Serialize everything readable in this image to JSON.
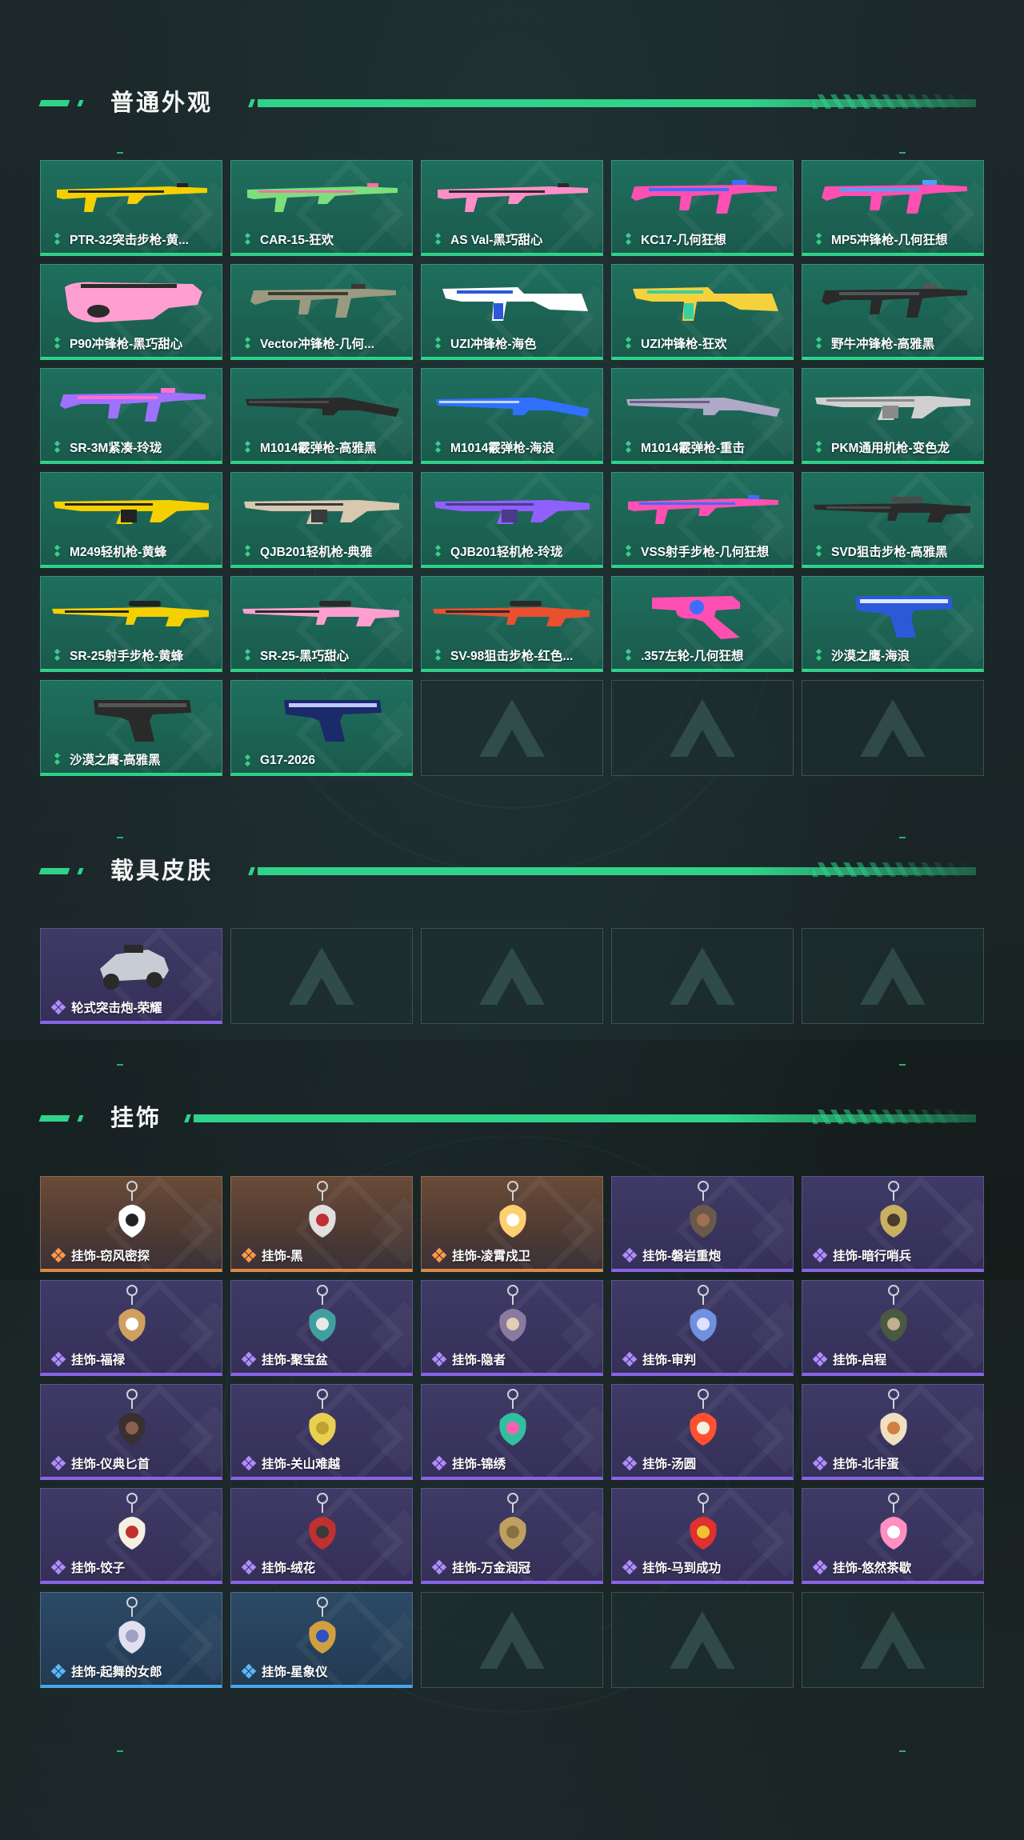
{
  "sections": {
    "weapons": {
      "title": "普通外观"
    },
    "vehicles": {
      "title": "载具皮肤"
    },
    "charms": {
      "title": "挂饰"
    }
  },
  "weapons": [
    {
      "label": "PTR-32突击步枪-黄...",
      "icon": "rifle",
      "colors": [
        "#f5d000",
        "#222"
      ]
    },
    {
      "label": "CAR-15-狂欢",
      "icon": "rifle",
      "colors": [
        "#7be07b",
        "#ff6ea8"
      ]
    },
    {
      "label": "AS Val-黑巧甜心",
      "icon": "rifle",
      "colors": [
        "#ff8ec8",
        "#2a2a2a"
      ]
    },
    {
      "label": "KC17-几何狂想",
      "icon": "smg",
      "colors": [
        "#ff4fb2",
        "#3f6cff"
      ]
    },
    {
      "label": "MP5冲锋枪-几何狂想",
      "icon": "smg",
      "colors": [
        "#ff4fb2",
        "#4fa0ff"
      ]
    },
    {
      "label": "P90冲锋枪-黑巧甜心",
      "icon": "p90",
      "colors": [
        "#ff9ed0",
        "#2a2a2a"
      ]
    },
    {
      "label": "Vector冲锋枪-几何...",
      "icon": "smg",
      "colors": [
        "#9a9a80",
        "#3a3a30"
      ]
    },
    {
      "label": "UZI冲锋枪-海色",
      "icon": "uzi",
      "colors": [
        "#ffffff",
        "#2a5ad8"
      ]
    },
    {
      "label": "UZI冲锋枪-狂欢",
      "icon": "uzi",
      "colors": [
        "#f5d23b",
        "#3ad0a0"
      ]
    },
    {
      "label": "野牛冲锋枪-高雅黑",
      "icon": "smg",
      "colors": [
        "#2a2a2a",
        "#555"
      ]
    },
    {
      "label": "SR-3M紧凑-玲珑",
      "icon": "smg",
      "colors": [
        "#a070ff",
        "#ff70d0"
      ]
    },
    {
      "label": "M1014霰弹枪-高雅黑",
      "icon": "shotgun",
      "colors": [
        "#2a2a2a",
        "#4a4a4a"
      ]
    },
    {
      "label": "M1014霰弹枪-海浪",
      "icon": "shotgun",
      "colors": [
        "#3070ff",
        "#c0d8ff"
      ]
    },
    {
      "label": "M1014霰弹枪-重击",
      "icon": "shotgun",
      "colors": [
        "#b0a8c8",
        "#6a6080"
      ]
    },
    {
      "label": "PKM通用机枪-变色龙",
      "icon": "lmg",
      "colors": [
        "#d0d0d0",
        "#8a8a8a"
      ]
    },
    {
      "label": "M249轻机枪-黄蜂",
      "icon": "lmg",
      "colors": [
        "#f5d000",
        "#222"
      ]
    },
    {
      "label": "QJB201轻机枪-典雅",
      "icon": "lmg",
      "colors": [
        "#d8c8b0",
        "#3a3a3a"
      ]
    },
    {
      "label": "QJB201轻机枪-玲珑",
      "icon": "lmg",
      "colors": [
        "#9060ff",
        "#4a3a8a"
      ]
    },
    {
      "label": "VSS射手步枪-几何狂想",
      "icon": "rifle",
      "colors": [
        "#ff4fb2",
        "#3f6cff"
      ]
    },
    {
      "label": "SVD狙击步枪-高雅黑",
      "icon": "sniper",
      "colors": [
        "#2a2a2a",
        "#4a4a4a"
      ]
    },
    {
      "label": "SR-25射手步枪-黄蜂",
      "icon": "sniper",
      "colors": [
        "#f5d000",
        "#222"
      ]
    },
    {
      "label": "SR-25-黑巧甜心",
      "icon": "sniper",
      "colors": [
        "#ff9ed0",
        "#2a2a2a"
      ]
    },
    {
      "label": "SV-98狙击步枪-红色...",
      "icon": "sniper",
      "colors": [
        "#e85030",
        "#2a2a2a"
      ]
    },
    {
      "label": ".357左轮-几何狂想",
      "icon": "revolver",
      "colors": [
        "#ff4fb2",
        "#3f6cff"
      ]
    },
    {
      "label": "沙漠之鹰-海浪",
      "icon": "pistol",
      "colors": [
        "#2a5ad8",
        "#e0e8ff"
      ]
    },
    {
      "label": "沙漠之鹰-高雅黑",
      "icon": "pistol",
      "colors": [
        "#2a2a2a",
        "#555"
      ]
    },
    {
      "label": "G17-2026",
      "icon": "pistol",
      "colors": [
        "#1a2a6a",
        "#c0c8ff"
      ]
    }
  ],
  "vehicles": [
    {
      "label": "轮式突击炮-荣耀",
      "icon": "vehicle",
      "colors": [
        "#c8ccd4",
        "#2a2a2a"
      ]
    }
  ],
  "charms": [
    {
      "label": "挂饰-窃风密探",
      "rarity": "orange",
      "colors": [
        "#ffffff",
        "#222"
      ]
    },
    {
      "label": "挂饰-黑",
      "rarity": "orange",
      "colors": [
        "#e0e0e0",
        "#c03030"
      ]
    },
    {
      "label": "挂饰-凌霄戍卫",
      "rarity": "orange",
      "colors": [
        "#ffd070",
        "#ffffff"
      ]
    },
    {
      "label": "挂饰-磐岩重炮",
      "rarity": "purple",
      "colors": [
        "#6a5a4a",
        "#a07050"
      ]
    },
    {
      "label": "挂饰-暗行哨兵",
      "rarity": "purple",
      "colors": [
        "#c8b060",
        "#4a3a30"
      ]
    },
    {
      "label": "挂饰-福禄",
      "rarity": "purple",
      "colors": [
        "#d0a060",
        "#ffffff"
      ]
    },
    {
      "label": "挂饰-聚宝盆",
      "rarity": "purple",
      "colors": [
        "#40a0a0",
        "#e8e8e8"
      ]
    },
    {
      "label": "挂饰-隐者",
      "rarity": "purple",
      "colors": [
        "#8a7aa0",
        "#e0d0b0"
      ]
    },
    {
      "label": "挂饰-审判",
      "rarity": "purple",
      "colors": [
        "#7090e0",
        "#e0e0ff"
      ]
    },
    {
      "label": "挂饰-启程",
      "rarity": "purple",
      "colors": [
        "#4a5a40",
        "#c0b090"
      ]
    },
    {
      "label": "挂饰-仪典匕首",
      "rarity": "purple",
      "colors": [
        "#3a3030",
        "#8a6050"
      ]
    },
    {
      "label": "挂饰-关山难越",
      "rarity": "purple",
      "colors": [
        "#e8d050",
        "#c0a030"
      ]
    },
    {
      "label": "挂饰-锦绣",
      "rarity": "purple",
      "colors": [
        "#30c0a0",
        "#ff60b0"
      ]
    },
    {
      "label": "挂饰-汤圆",
      "rarity": "purple",
      "colors": [
        "#ff5030",
        "#f5f0e0"
      ]
    },
    {
      "label": "挂饰-北非蛋",
      "rarity": "purple",
      "colors": [
        "#f0e0c0",
        "#d08040"
      ]
    },
    {
      "label": "挂饰-饺子",
      "rarity": "purple",
      "colors": [
        "#f5f0e0",
        "#c03030"
      ]
    },
    {
      "label": "挂饰-绒花",
      "rarity": "purple",
      "colors": [
        "#c03030",
        "#3a3a3a"
      ]
    },
    {
      "label": "挂饰-万金润冠",
      "rarity": "purple",
      "colors": [
        "#c0a060",
        "#8a7040"
      ]
    },
    {
      "label": "挂饰-马到成功",
      "rarity": "purple",
      "colors": [
        "#e03030",
        "#f0c030"
      ]
    },
    {
      "label": "挂饰-悠然茶歇",
      "rarity": "purple",
      "colors": [
        "#ff90c0",
        "#ffffff"
      ]
    },
    {
      "label": "挂饰-起舞的女郎",
      "rarity": "blue",
      "colors": [
        "#e0e0f0",
        "#a0a0c0"
      ]
    },
    {
      "label": "挂饰-星象仪",
      "rarity": "blue",
      "colors": [
        "#d0a040",
        "#3050c0"
      ]
    }
  ],
  "empty_slots": {
    "weapons": 3,
    "vehicles": 4,
    "charms": 3
  },
  "colors": {
    "accent": "#2fd38a",
    "rarity_green": "#2fd38a",
    "rarity_purple": "#8a64e6",
    "rarity_orange": "#e08840",
    "rarity_blue": "#48a6e6"
  }
}
